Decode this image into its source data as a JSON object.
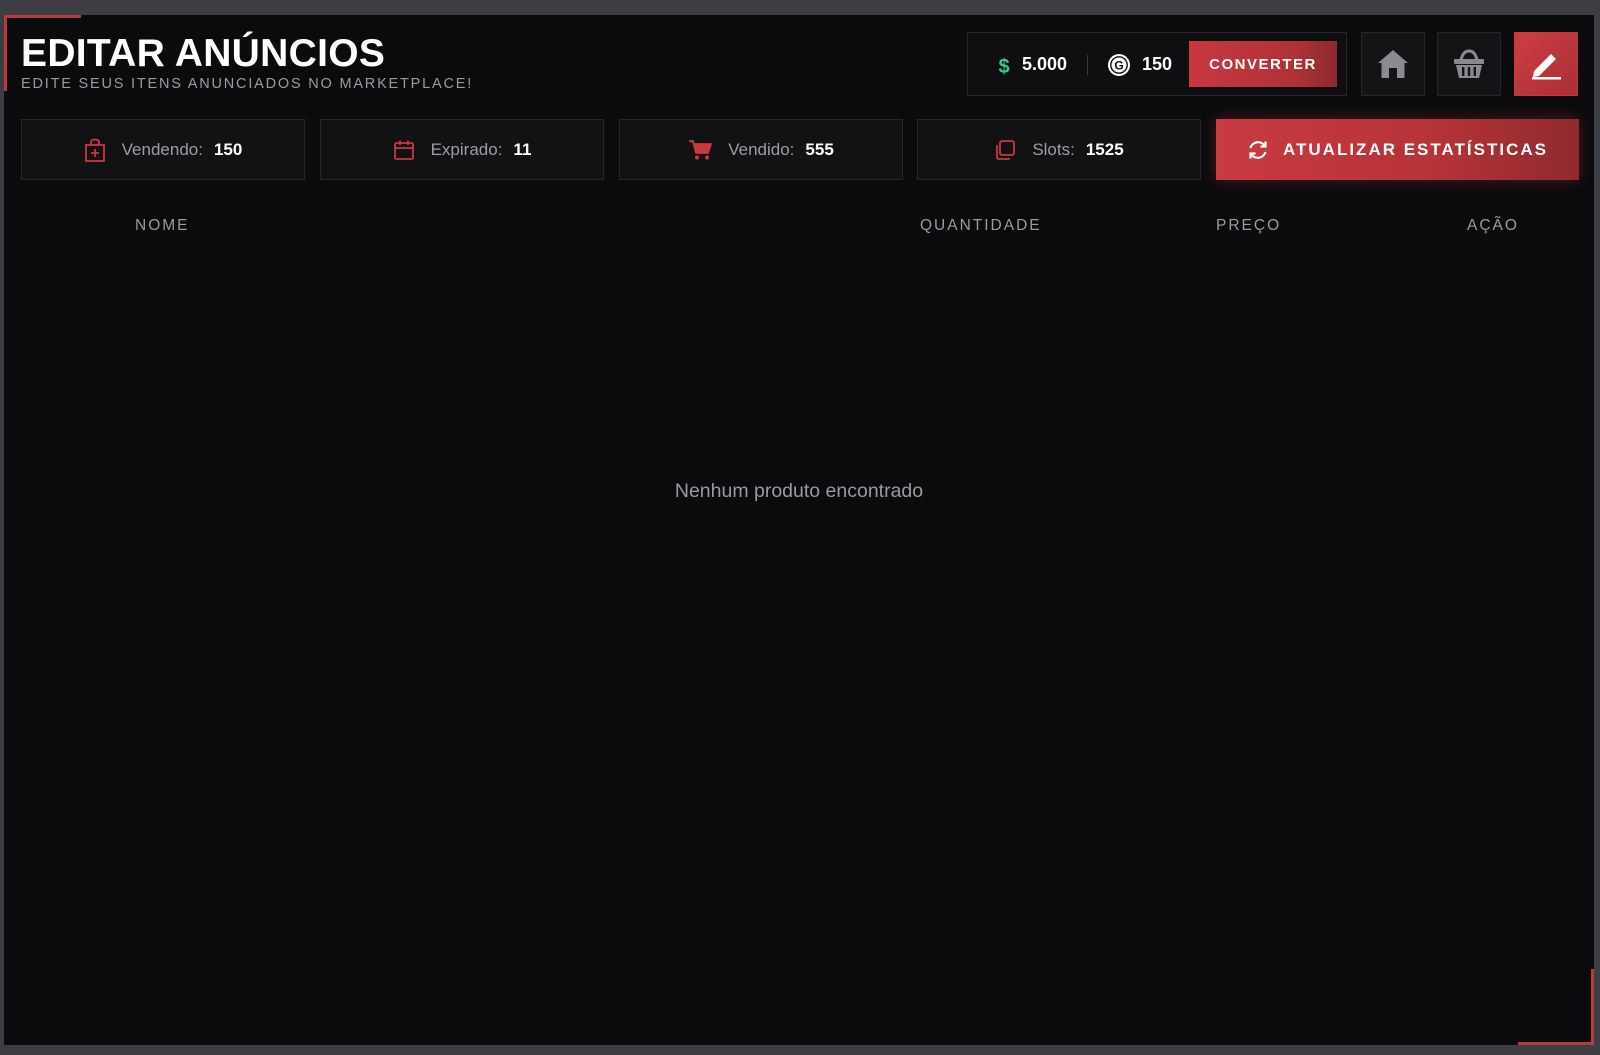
{
  "header": {
    "title": "EDITAR ANÚNCIOS",
    "subtitle": "EDITE SEUS ITENS ANUNCIADOS NO MARKETPLACE!"
  },
  "wallet": {
    "money_icon": "dollar-icon",
    "money": "5.000",
    "coin_icon": "g-coin-icon",
    "coins": "150",
    "convert_label": "CONVERTER"
  },
  "nav": {
    "home_icon": "home-icon",
    "basket_icon": "basket-icon",
    "edit_icon": "edit-icon"
  },
  "stats": [
    {
      "icon": "shopping-bag-icon",
      "label": "Vendendo:",
      "value": "150"
    },
    {
      "icon": "calendar-icon",
      "label": "Expirado:",
      "value": "11"
    },
    {
      "icon": "cart-icon",
      "label": "Vendido:",
      "value": "555"
    },
    {
      "icon": "slots-icon",
      "label": "Slots:",
      "value": "1525"
    }
  ],
  "refresh": {
    "icon": "refresh-icon",
    "label": "ATUALIZAR ESTATÍSTICAS"
  },
  "table": {
    "columns": [
      "NOME",
      "QUANTIDADE",
      "PREÇO",
      "AÇÃO"
    ],
    "empty_message": "Nenhum produto encontrado"
  },
  "colors": {
    "accent": "#c8383f",
    "background": "#0b0b0d",
    "money_green": "#2ecc8a"
  }
}
